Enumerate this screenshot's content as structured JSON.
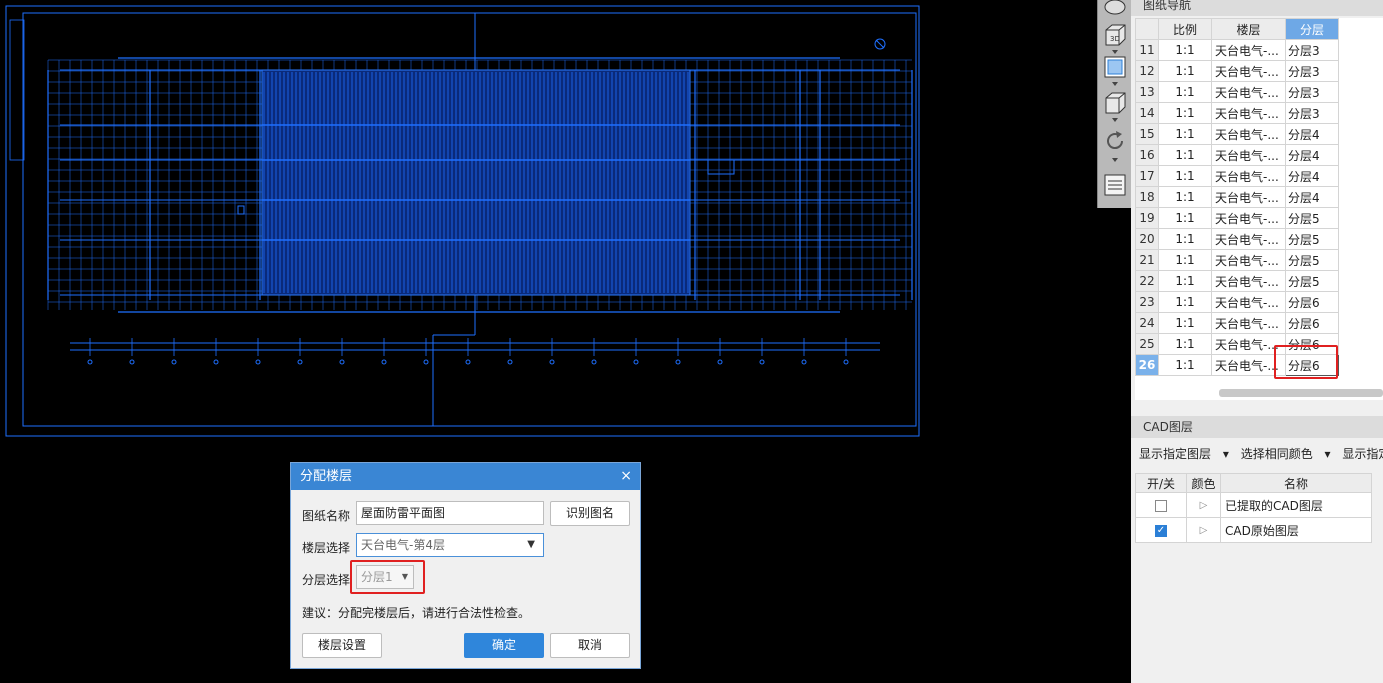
{
  "dialog": {
    "title": "分配楼层",
    "close": "×",
    "drawing_name_label": "图纸名称",
    "drawing_name_value": "屋面防雷平面图",
    "recognize_button": "识别图名",
    "floor_label": "楼层选择",
    "floor_value": "天台电气-第4层",
    "layer_label": "分层选择",
    "layer_value": "分层1",
    "hint": "建议：分配完楼层后，请进行合法性检查。",
    "floor_settings_button": "楼层设置",
    "ok_button": "确定",
    "cancel_button": "取消"
  },
  "nav_panel": {
    "title": "图纸导航",
    "headers": [
      "比例",
      "楼层",
      "分层"
    ],
    "rows": [
      {
        "num": "11",
        "scale": "1:1",
        "floor": "天台电气-...",
        "layer": "分层3"
      },
      {
        "num": "12",
        "scale": "1:1",
        "floor": "天台电气-...",
        "layer": "分层3"
      },
      {
        "num": "13",
        "scale": "1:1",
        "floor": "天台电气-...",
        "layer": "分层3"
      },
      {
        "num": "14",
        "scale": "1:1",
        "floor": "天台电气-...",
        "layer": "分层3"
      },
      {
        "num": "15",
        "scale": "1:1",
        "floor": "天台电气-...",
        "layer": "分层4"
      },
      {
        "num": "16",
        "scale": "1:1",
        "floor": "天台电气-...",
        "layer": "分层4"
      },
      {
        "num": "17",
        "scale": "1:1",
        "floor": "天台电气-...",
        "layer": "分层4"
      },
      {
        "num": "18",
        "scale": "1:1",
        "floor": "天台电气-...",
        "layer": "分层4"
      },
      {
        "num": "19",
        "scale": "1:1",
        "floor": "天台电气-...",
        "layer": "分层5"
      },
      {
        "num": "20",
        "scale": "1:1",
        "floor": "天台电气-...",
        "layer": "分层5"
      },
      {
        "num": "21",
        "scale": "1:1",
        "floor": "天台电气-...",
        "layer": "分层5"
      },
      {
        "num": "22",
        "scale": "1:1",
        "floor": "天台电气-...",
        "layer": "分层5"
      },
      {
        "num": "23",
        "scale": "1:1",
        "floor": "天台电气-...",
        "layer": "分层6"
      },
      {
        "num": "24",
        "scale": "1:1",
        "floor": "天台电气-...",
        "layer": "分层6"
      },
      {
        "num": "25",
        "scale": "1:1",
        "floor": "天台电气-...",
        "layer": "分层6"
      },
      {
        "num": "26",
        "scale": "1:1",
        "floor": "天台电气-...",
        "layer": "分层6"
      }
    ]
  },
  "cad_layers": {
    "title": "CAD图层",
    "toolbar": [
      "显示指定图层",
      "选择相同颜色",
      "显示指定图"
    ],
    "headers": [
      "开/关",
      "颜色",
      "名称"
    ],
    "rows": [
      {
        "on": false,
        "name": "已提取的CAD图层"
      },
      {
        "on": true,
        "name": "CAD原始图层"
      }
    ]
  },
  "toolbar_icons": [
    "cube-view-icon",
    "3d-view-icon",
    "top-view-icon",
    "box-view-icon",
    "rotate-icon",
    "layer-list-icon"
  ],
  "colors": {
    "cad_line": "#1e6fff",
    "accent": "#2f86db",
    "highlight": "#e02020"
  }
}
